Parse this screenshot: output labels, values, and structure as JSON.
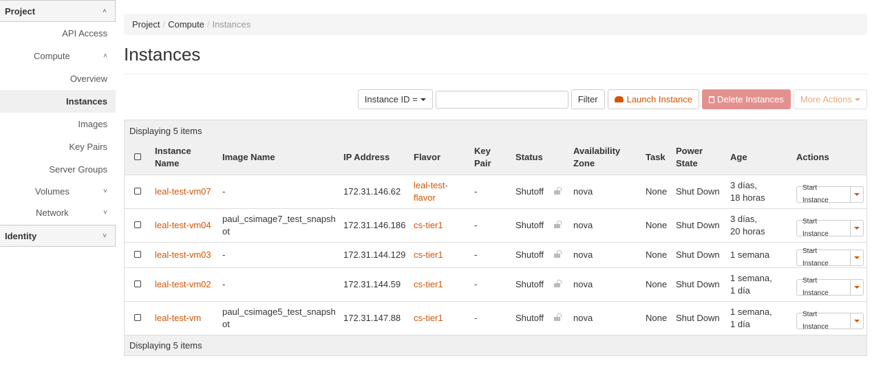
{
  "sidebar": {
    "project": "Project",
    "api_access": "API Access",
    "compute": "Compute",
    "overview": "Overview",
    "instances": "Instances",
    "images": "Images",
    "key_pairs": "Key Pairs",
    "server_groups": "Server Groups",
    "volumes": "Volumes",
    "network": "Network",
    "identity": "Identity",
    "chev_up": "˄",
    "chev_down": "˅"
  },
  "breadcrumb": [
    "Project",
    "Compute",
    "Instances"
  ],
  "page_title": "Instances",
  "toolbar": {
    "filter_select": "Instance ID =",
    "filter_placeholder": "",
    "filter_button": "Filter",
    "launch": "Launch Instance",
    "delete": "Delete Instances",
    "more": "More Actions"
  },
  "table": {
    "caption": "Displaying 5 items",
    "footer": "Displaying 5 items",
    "headers": {
      "name": [
        "Instance",
        "Name"
      ],
      "image": "Image Name",
      "ip": "IP Address",
      "flavor": "Flavor",
      "keypair": [
        "Key",
        "Pair"
      ],
      "status": "Status",
      "az": [
        "Availability",
        "Zone"
      ],
      "task": "Task",
      "power": [
        "Power",
        "State"
      ],
      "age": "Age",
      "actions": "Actions"
    },
    "rows": [
      {
        "name": "leal-test-vm07",
        "image": [
          "-"
        ],
        "ip": "172.31.146.62",
        "flavor": [
          "leal-test-",
          "flavor"
        ],
        "keypair": "-",
        "status": "Shutoff",
        "az": "nova",
        "task": "None",
        "power": "Shut Down",
        "age": [
          "3 días,",
          "18 horas"
        ],
        "action": "Start Instance"
      },
      {
        "name": "leal-test-vm04",
        "image": [
          "paul_csimage7_test_snapsh",
          "ot"
        ],
        "ip": "172.31.146.186",
        "flavor": [
          "cs-tier1"
        ],
        "keypair": "-",
        "status": "Shutoff",
        "az": "nova",
        "task": "None",
        "power": "Shut Down",
        "age": [
          "3 días,",
          "20 horas"
        ],
        "action": "Start Instance"
      },
      {
        "name": "leal-test-vm03",
        "image": [
          "-"
        ],
        "ip": "172.31.144.129",
        "flavor": [
          "cs-tier1"
        ],
        "keypair": "-",
        "status": "Shutoff",
        "az": "nova",
        "task": "None",
        "power": "Shut Down",
        "age": [
          "1 semana"
        ],
        "action": "Start Instance"
      },
      {
        "name": "leal-test-vm02",
        "image": [
          "-"
        ],
        "ip": "172.31.144.59",
        "flavor": [
          "cs-tier1"
        ],
        "keypair": "-",
        "status": "Shutoff",
        "az": "nova",
        "task": "None",
        "power": "Shut Down",
        "age": [
          "1 semana,",
          "1 día"
        ],
        "action": "Start Instance"
      },
      {
        "name": "leal-test-vm",
        "image": [
          "paul_csimage5_test_snapsh",
          "ot"
        ],
        "ip": "172.31.147.88",
        "flavor": [
          "cs-tier1"
        ],
        "keypair": "-",
        "status": "Shutoff",
        "az": "nova",
        "task": "None",
        "power": "Shut Down",
        "age": [
          "1 semana,",
          "1 día"
        ],
        "action": "Start Instance"
      }
    ]
  }
}
